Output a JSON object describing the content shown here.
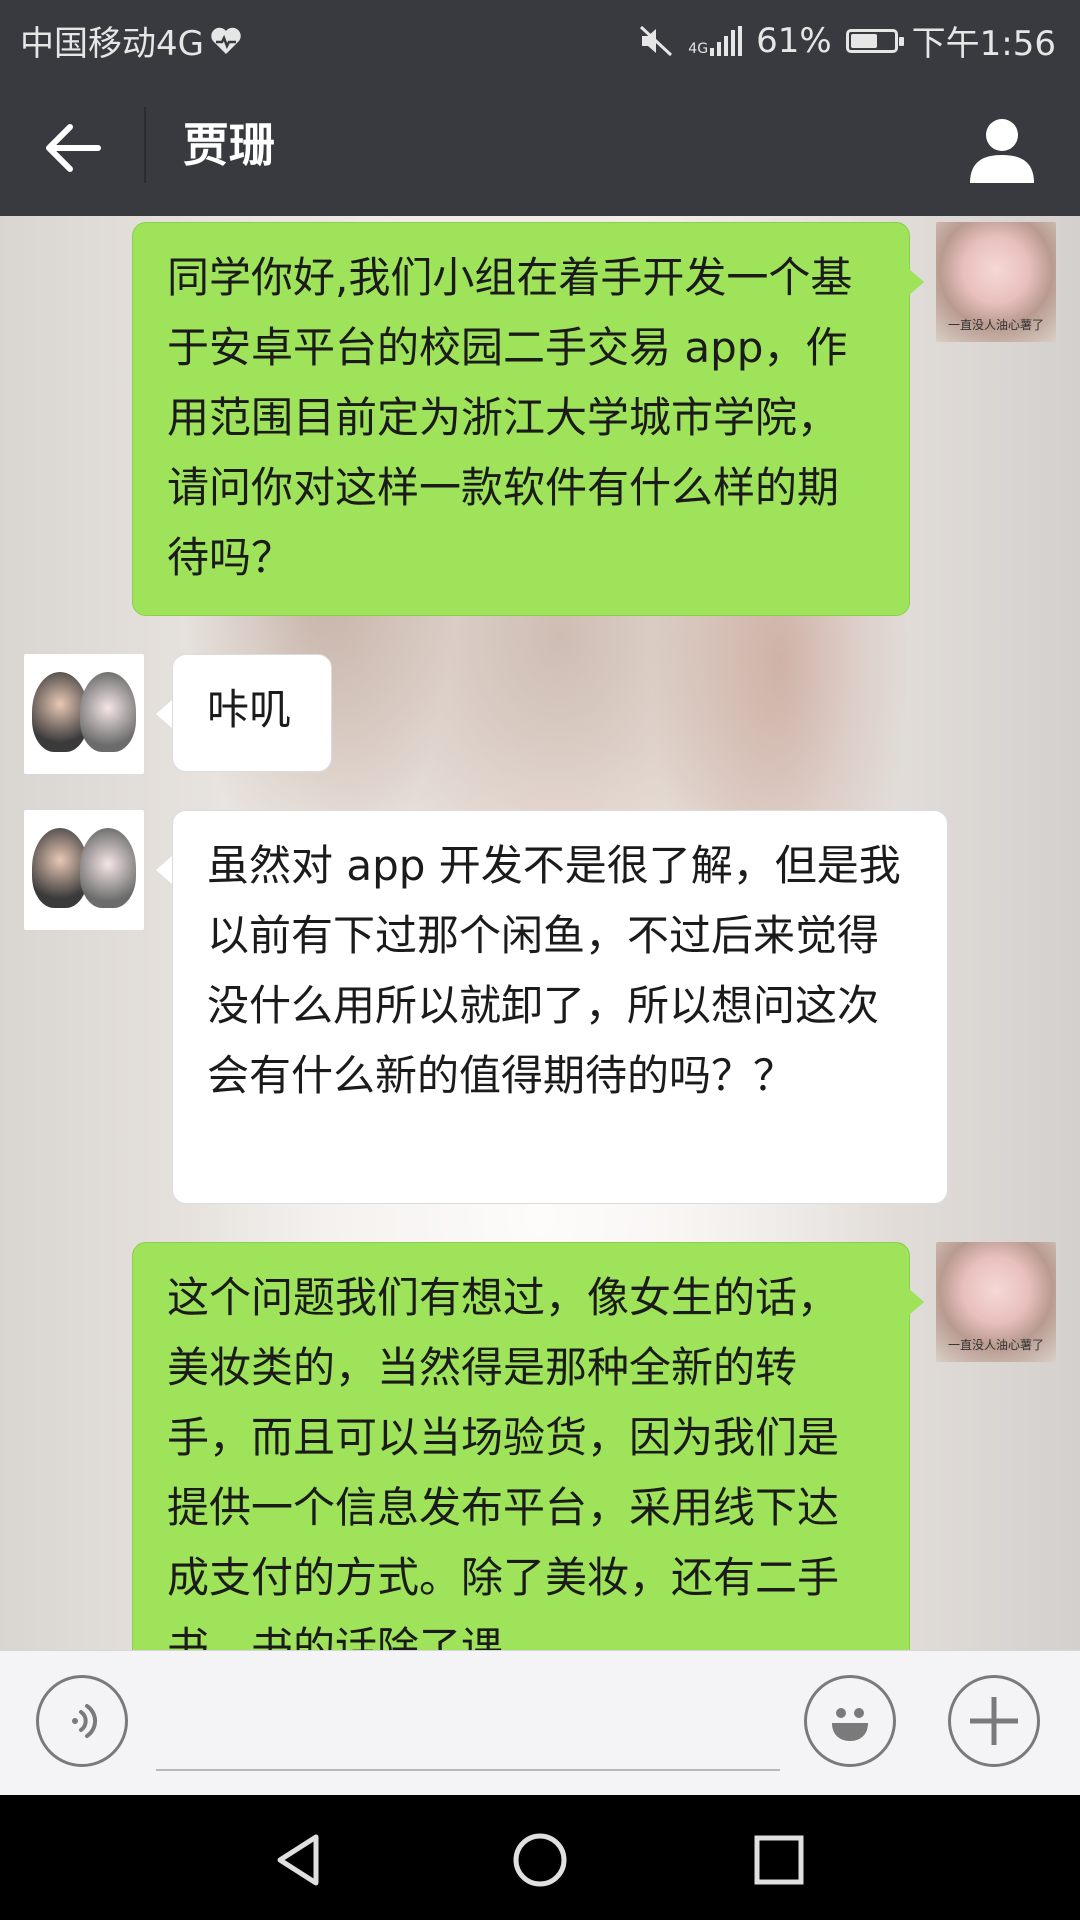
{
  "status_bar": {
    "carrier": "中国移动4G",
    "battery_percent": "61%",
    "battery_level": 0.61,
    "time": "下午1:56",
    "icons": [
      "heart-health-icon",
      "mute-icon",
      "4g-signal-icon",
      "battery-icon"
    ]
  },
  "header": {
    "title": "贾珊",
    "back_icon": "back-arrow-icon",
    "profile_icon": "profile-icon"
  },
  "messages": [
    {
      "sender": "me",
      "text": "同学你好,我们小组在着手开发一个基于安卓平台的校园二手交易 app，作用范围目前定为浙江大学城市学院，请问你对这样一款软件有什么样的期待吗？"
    },
    {
      "sender": "other",
      "text": "咔叽"
    },
    {
      "sender": "other",
      "text": "虽然对 app 开发不是很了解，但是我以前有下过那个闲鱼，不过后来觉得没什么用所以就卸了，所以想问这次会有什么新的值得期待的吗？？"
    },
    {
      "sender": "me",
      "text": "这个问题我们有想过，像女生的话，美妆类的，当然得是那种全新的转手，而且可以当场验货，因为我们是提供一个信息发布平台，采用线下达成支付的方式。除了美妆，还有二手书，书的话除了课"
    }
  ],
  "my_avatar_caption": "一直没人油心薯了",
  "input_bar": {
    "voice_icon": "voice-icon",
    "emoji_icon": "emoji-icon",
    "more_icon": "plus-icon"
  },
  "nav_bar": {
    "icons": [
      "back-triangle-icon",
      "home-circle-icon",
      "recents-square-icon"
    ]
  }
}
